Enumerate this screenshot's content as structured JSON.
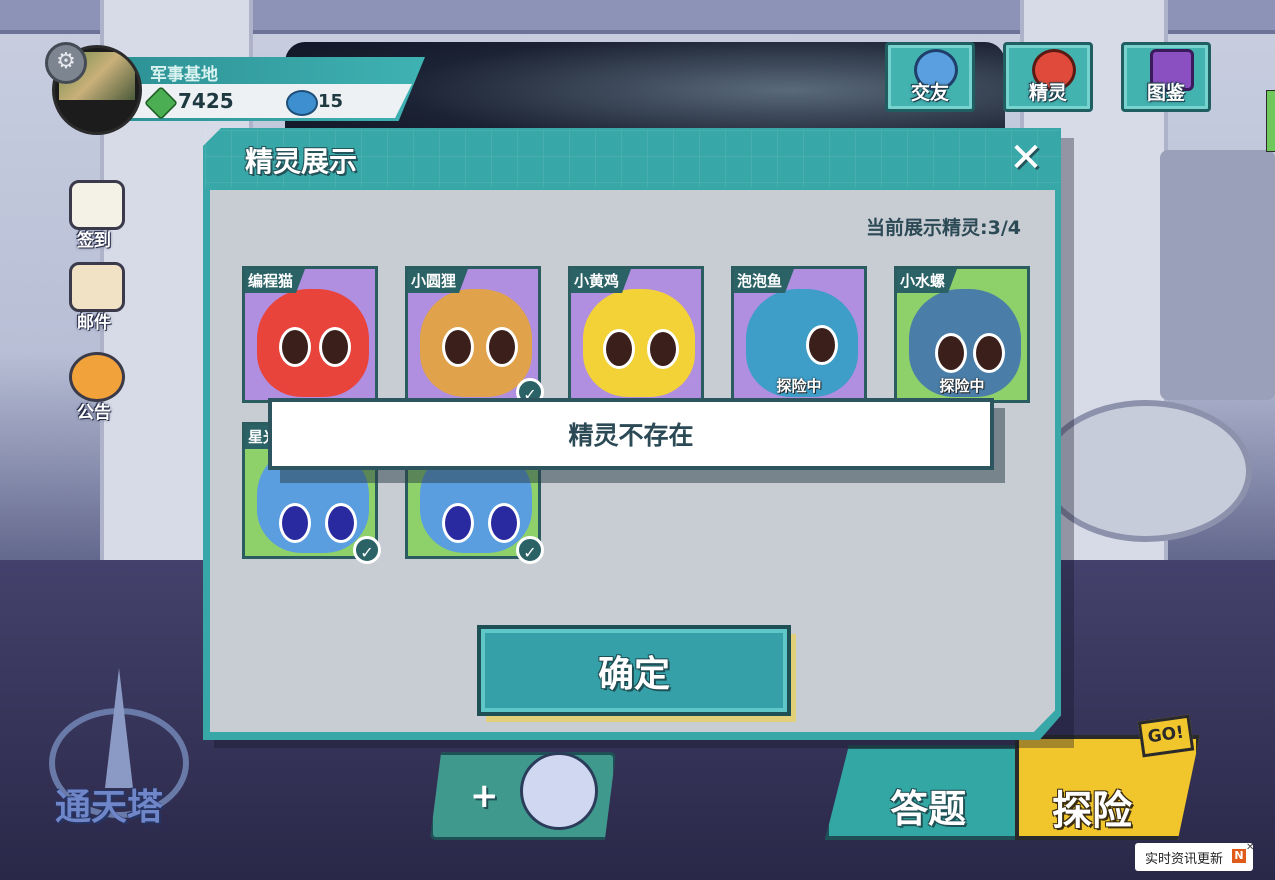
{
  "player": {
    "name": "军事基地",
    "gems": "7425",
    "crystals": "15"
  },
  "top_menu": [
    {
      "label": "交友",
      "icon": "chat-bubble-icon",
      "color": "#5aa0e0"
    },
    {
      "label": "精灵",
      "icon": "red-cat-icon",
      "color": "#e04a3a"
    },
    {
      "label": "图鉴",
      "icon": "purple-book-icon",
      "color": "#8a4fc0"
    }
  ],
  "side_menu": [
    {
      "label": "签到",
      "icon": "calendar-icon"
    },
    {
      "label": "邮件",
      "icon": "envelope-icon"
    },
    {
      "label": "公告",
      "icon": "megaphone-icon"
    }
  ],
  "modal": {
    "title": "精灵展示",
    "count_label": "当前展示精灵:3/4",
    "confirm": "确定"
  },
  "pets": [
    {
      "name": "编程猫",
      "status": "",
      "checked": false,
      "bg": "#b08ee0",
      "body": "#e8443c"
    },
    {
      "name": "小圆狸",
      "status": "",
      "checked": true,
      "bg": "#b08ee0",
      "body": "#e0a24a"
    },
    {
      "name": "小黄鸡",
      "status": "",
      "checked": false,
      "bg": "#b08ee0",
      "body": "#f3d238"
    },
    {
      "name": "泡泡鱼",
      "status": "探险中",
      "checked": false,
      "bg": "#b08ee0",
      "body": "#3e9ec8"
    },
    {
      "name": "小水螺",
      "status": "探险中",
      "checked": false,
      "bg": "#8ed06a",
      "body": "#4a7ea8"
    },
    {
      "name": "星光",
      "status": "",
      "checked": true,
      "bg": "#8ed06a",
      "body": "#5a9ee0"
    },
    {
      "name": "",
      "status": "",
      "checked": true,
      "bg": "#8ed06a",
      "body": "#5a9ee0"
    }
  ],
  "toast": "精灵不存在",
  "bottom": {
    "tower": "通天塔",
    "answer": "答题",
    "explore": "探险",
    "go": "GO!",
    "news": "实时资讯更新"
  }
}
